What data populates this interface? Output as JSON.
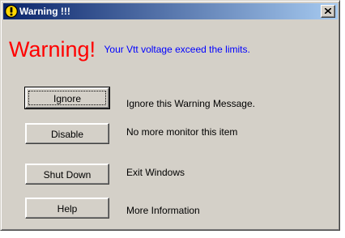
{
  "window": {
    "title": "Warning !!!",
    "icon": "warning-exclamation-icon",
    "close_icon": "close-icon",
    "close_label": "×"
  },
  "headline": {
    "warning_text": "Warning!",
    "message": "Your Vtt voltage exceed the limits."
  },
  "actions": [
    {
      "button_label": "Ignore",
      "description": "Ignore this Warning Message."
    },
    {
      "button_label": "Disable",
      "description": "No more monitor this item"
    },
    {
      "button_label": "Shut Down",
      "description": "Exit Windows"
    },
    {
      "button_label": "Help",
      "description": "More Information"
    }
  ],
  "colors": {
    "titlebar_start": "#0a246a",
    "titlebar_end": "#a6caf0",
    "warning_red": "#ff0000",
    "message_blue": "#0000ff",
    "face": "#d4d0c8",
    "icon_yellow": "#ffd700"
  }
}
